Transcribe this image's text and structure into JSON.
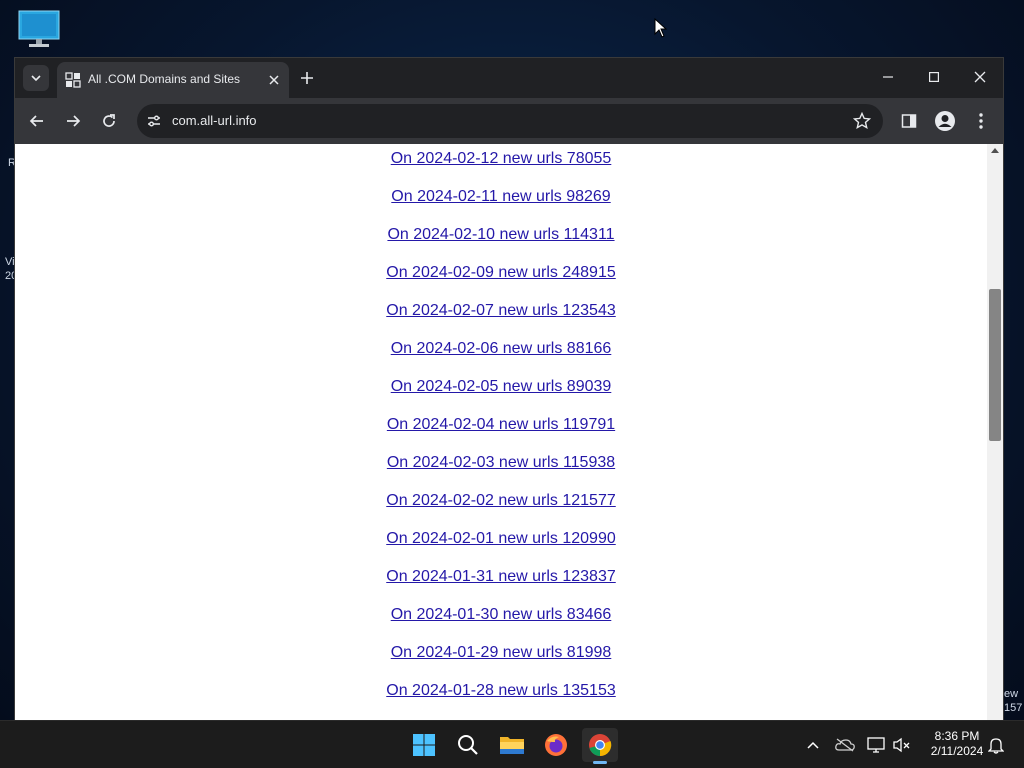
{
  "desktop": {
    "edge_labels": [
      "R",
      "Vi",
      "20",
      "ew",
      "157"
    ]
  },
  "browser": {
    "tab": {
      "title": "All .COM Domains and Sites"
    },
    "address": {
      "url": "com.all-url.info"
    },
    "links": [
      "On 2024-02-12 new urls 78055",
      "On 2024-02-11 new urls 98269",
      "On 2024-02-10 new urls 114311",
      "On 2024-02-09 new urls 248915",
      "On 2024-02-07 new urls 123543",
      "On 2024-02-06 new urls 88166",
      "On 2024-02-05 new urls 89039",
      "On 2024-02-04 new urls 119791",
      "On 2024-02-03 new urls 115938",
      "On 2024-02-02 new urls 121577",
      "On 2024-02-01 new urls 120990",
      "On 2024-01-31 new urls 123837",
      "On 2024-01-30 new urls 83466",
      "On 2024-01-29 new urls 81998",
      "On 2024-01-28 new urls 135153"
    ]
  },
  "taskbar": {
    "apps": [
      "start-icon",
      "search-icon",
      "file-explorer-icon",
      "firefox-icon",
      "chrome-icon"
    ],
    "clock": {
      "time": "8:36 PM",
      "date": "2/11/2024"
    }
  },
  "colors": {
    "link": "#2418a8",
    "browser_frame": "#202124",
    "toolbar": "#35363a",
    "taskbar": "#1c1c1c"
  }
}
